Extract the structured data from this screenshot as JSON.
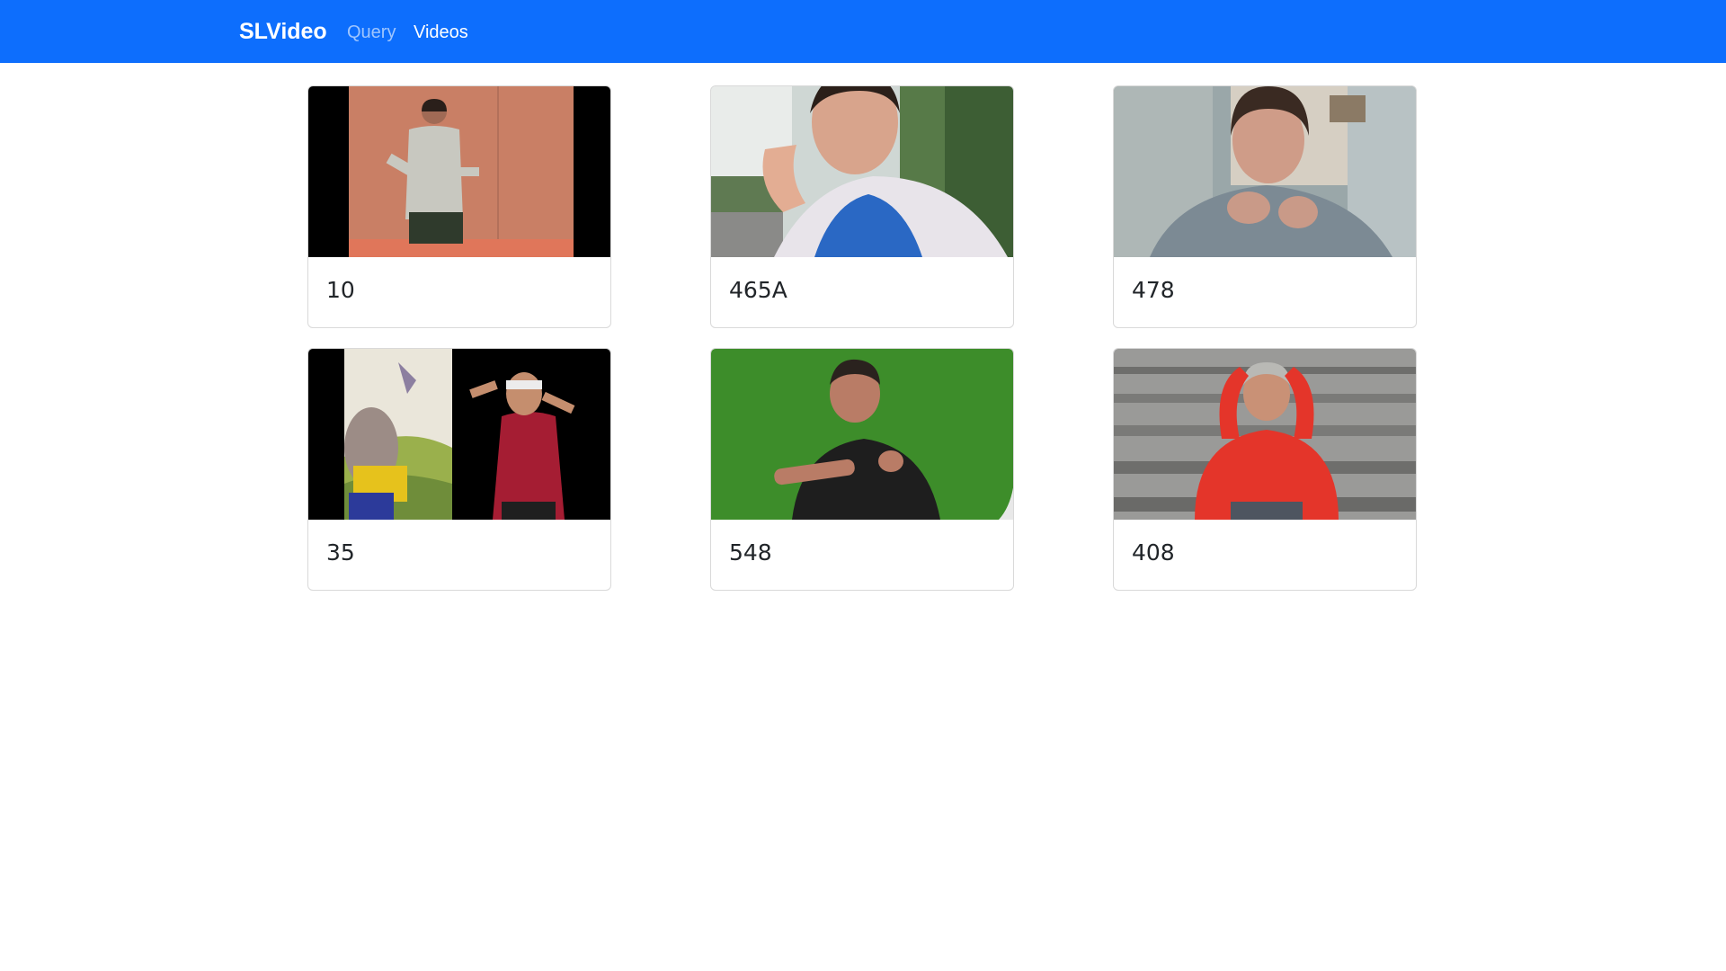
{
  "navbar": {
    "brand": "SLVideo",
    "links": [
      {
        "label": "Query",
        "active": false
      },
      {
        "label": "Videos",
        "active": true
      }
    ],
    "color": "#0d6efd"
  },
  "videos": [
    {
      "title": "10",
      "thumbnail": "man signing on stage"
    },
    {
      "title": "465A",
      "thumbnail": "woman signing outdoors selfie"
    },
    {
      "title": "478",
      "thumbnail": "woman signing indoors"
    },
    {
      "title": "35",
      "thumbnail": "woman signing beside cartoon backdrop"
    },
    {
      "title": "548",
      "thumbnail": "man signing on green screen"
    },
    {
      "title": "408",
      "thumbnail": "man in red jacket signing on stadium steps"
    }
  ]
}
